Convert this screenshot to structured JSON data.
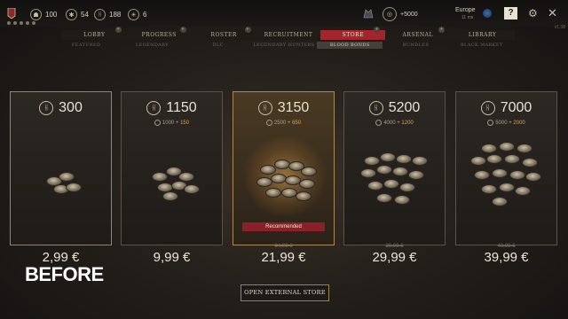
{
  "topbar": {
    "resources": [
      {
        "icon": "banner-icon",
        "value": ""
      },
      {
        "icon": "character-icon",
        "value": "100"
      },
      {
        "icon": "cog-currency-icon",
        "value": "54"
      },
      {
        "icon": "blood-bond-currency-icon",
        "value": "188"
      },
      {
        "icon": "sun-currency-icon",
        "value": "6"
      }
    ],
    "currency_bonus": "+5000",
    "region": "Europe",
    "ping": "11 ms",
    "help_label": "?",
    "version": "v1.38"
  },
  "nav": {
    "tabs": [
      "LOBBY",
      "PROGRESS",
      "ROSTER",
      "RECRUITMENT",
      "STORE",
      "ARSENAL",
      "LIBRARY"
    ],
    "active_tab": "STORE"
  },
  "subnav": {
    "tabs": [
      "FEATURED",
      "LEGENDARY",
      "DLC",
      "LEGENDARY HUNTERS",
      "BLOOD BONDS",
      "BUNDLES",
      "BLACK MARKET"
    ],
    "active_tab": "BLOOD BONDS"
  },
  "packs": [
    {
      "amount": "300",
      "base": "",
      "bonus": "",
      "price": "2,99 €",
      "old_price": "",
      "recommended": ""
    },
    {
      "amount": "1150",
      "base": "1000",
      "bonus": "+ 150",
      "price": "9,99 €",
      "old_price": "",
      "recommended": ""
    },
    {
      "amount": "3150",
      "base": "2500",
      "bonus": "+ 650",
      "price": "21,99 €",
      "old_price": "24,99 €",
      "recommended": "Recommended"
    },
    {
      "amount": "5200",
      "base": "4000",
      "bonus": "+ 1200",
      "price": "29,99 €",
      "old_price": "39,99 €",
      "recommended": ""
    },
    {
      "amount": "7000",
      "base": "5000",
      "bonus": "+ 2000",
      "price": "39,99 €",
      "old_price": "49,99 €",
      "recommended": ""
    }
  ],
  "overlay_text": "BEFORE",
  "external_store_button": "OPEN EXTERNAL STORE",
  "colors": {
    "accent_red": "#a3242a",
    "gold": "#a2813f",
    "bonus_orange": "#e9a23a"
  }
}
